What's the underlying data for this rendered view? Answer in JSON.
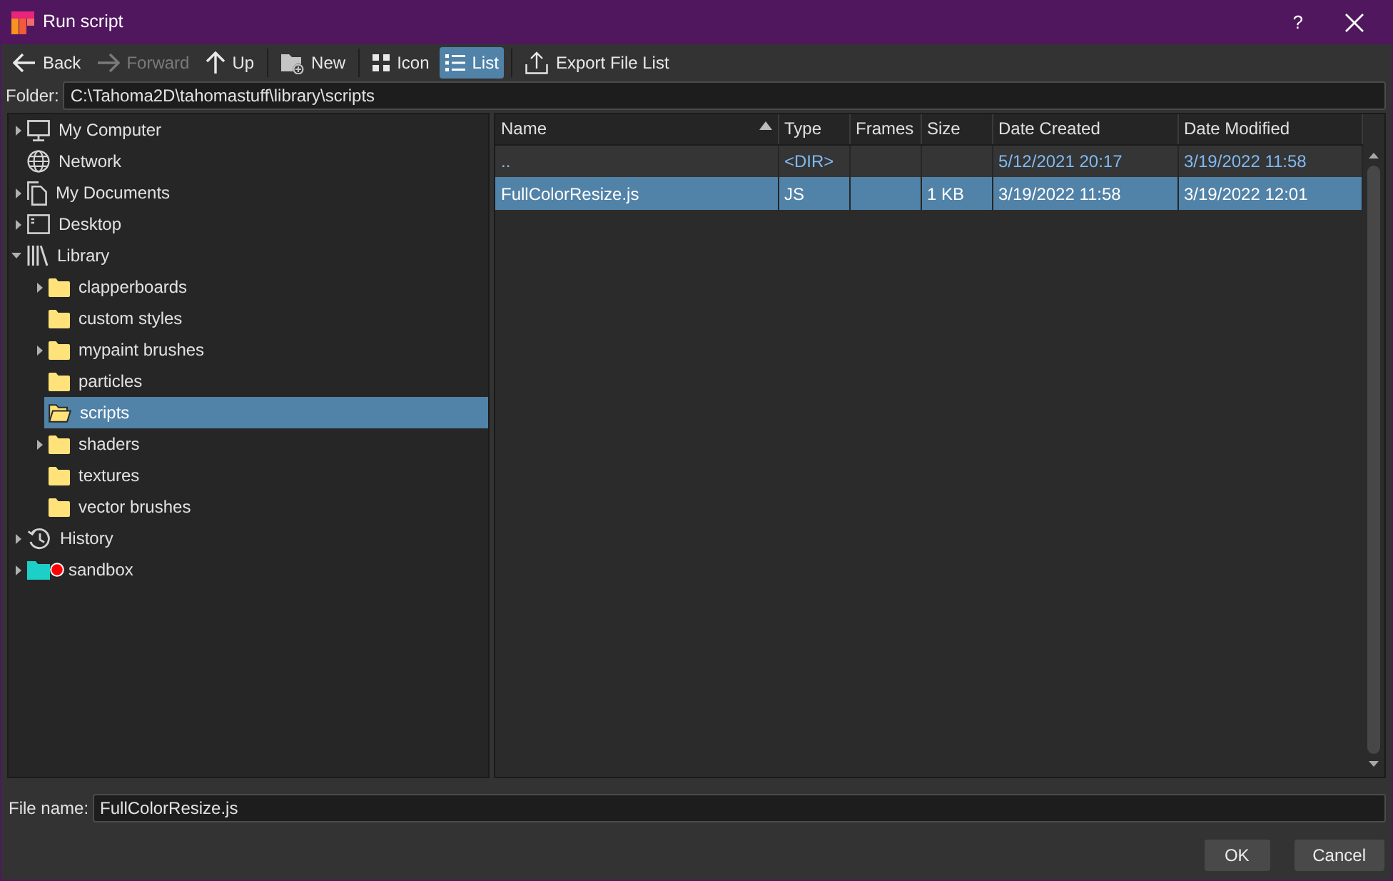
{
  "window": {
    "title": "Run script",
    "help": "?"
  },
  "toolbar": {
    "groups": [
      [
        {
          "label": "Back",
          "kind": "back",
          "disabled": false,
          "selected": false
        },
        {
          "label": "Forward",
          "kind": "forward",
          "disabled": true,
          "selected": false
        },
        {
          "label": "Up",
          "kind": "up",
          "disabled": false,
          "selected": false
        }
      ],
      [
        {
          "label": "New",
          "kind": "new_folder",
          "disabled": false,
          "selected": false
        }
      ],
      [
        {
          "label": "Icon",
          "kind": "icon_view",
          "disabled": false,
          "selected": false
        },
        {
          "label": "List",
          "kind": "list_view",
          "disabled": false,
          "selected": true
        }
      ],
      [
        {
          "label": "Export File List",
          "kind": "export",
          "disabled": false,
          "selected": false
        }
      ]
    ]
  },
  "folder": {
    "label": "Folder:",
    "value": "C:\\Tahoma2D\\tahomastuff\\library\\scripts"
  },
  "tree": [
    {
      "label": "My Computer",
      "kind": "computer",
      "has_children": true,
      "expanded": false,
      "selected": false
    },
    {
      "label": "Network",
      "kind": "network",
      "has_children": false,
      "expanded": false,
      "selected": false
    },
    {
      "label": "My Documents",
      "kind": "documents",
      "has_children": true,
      "expanded": false,
      "selected": false
    },
    {
      "label": "Desktop",
      "kind": "desktop",
      "has_children": true,
      "expanded": false,
      "selected": false
    },
    {
      "label": "Library",
      "kind": "library",
      "has_children": true,
      "expanded": true,
      "selected": false,
      "children": [
        {
          "label": "clapperboards",
          "kind": "folder",
          "has_children": true,
          "expanded": false,
          "selected": false
        },
        {
          "label": "custom styles",
          "kind": "folder",
          "has_children": false,
          "expanded": false,
          "selected": false
        },
        {
          "label": "mypaint brushes",
          "kind": "folder",
          "has_children": true,
          "expanded": false,
          "selected": false
        },
        {
          "label": "particles",
          "kind": "folder",
          "has_children": false,
          "expanded": false,
          "selected": false
        },
        {
          "label": "scripts",
          "kind": "folder",
          "has_children": false,
          "expanded": false,
          "selected": true
        },
        {
          "label": "shaders",
          "kind": "folder",
          "has_children": true,
          "expanded": false,
          "selected": false
        },
        {
          "label": "textures",
          "kind": "folder",
          "has_children": false,
          "expanded": false,
          "selected": false
        },
        {
          "label": "vector brushes",
          "kind": "folder",
          "has_children": false,
          "expanded": false,
          "selected": false
        }
      ]
    },
    {
      "label": "History",
      "kind": "history",
      "has_children": true,
      "expanded": false,
      "selected": false
    },
    {
      "label": "sandbox",
      "kind": "project",
      "has_children": true,
      "expanded": false,
      "selected": false
    }
  ],
  "file_list": {
    "columns": [
      {
        "label": "Name",
        "sorted": true
      },
      {
        "label": "Type",
        "sorted": false
      },
      {
        "label": "Frames",
        "sorted": false
      },
      {
        "label": "Size",
        "sorted": false
      },
      {
        "label": "Date Created",
        "sorted": false
      },
      {
        "label": "Date Modified",
        "sorted": false
      }
    ],
    "rows": [
      {
        "kind": "parent",
        "selected": false,
        "name": "..",
        "type": "<DIR>",
        "date_created": "5/12/2021 20:17",
        "date_modified": "3/19/2022 11:58"
      },
      {
        "kind": "file",
        "selected": true,
        "name": "FullColorResize.js",
        "type": "JS",
        "size": "1 KB",
        "date_created": "3/19/2022 11:58",
        "date_modified": "3/19/2022 12:01"
      }
    ]
  },
  "file_name": {
    "label": "File name:",
    "value": "FullColorResize.js"
  },
  "buttons": [
    {
      "label": "OK"
    },
    {
      "label": "Cancel"
    }
  ]
}
